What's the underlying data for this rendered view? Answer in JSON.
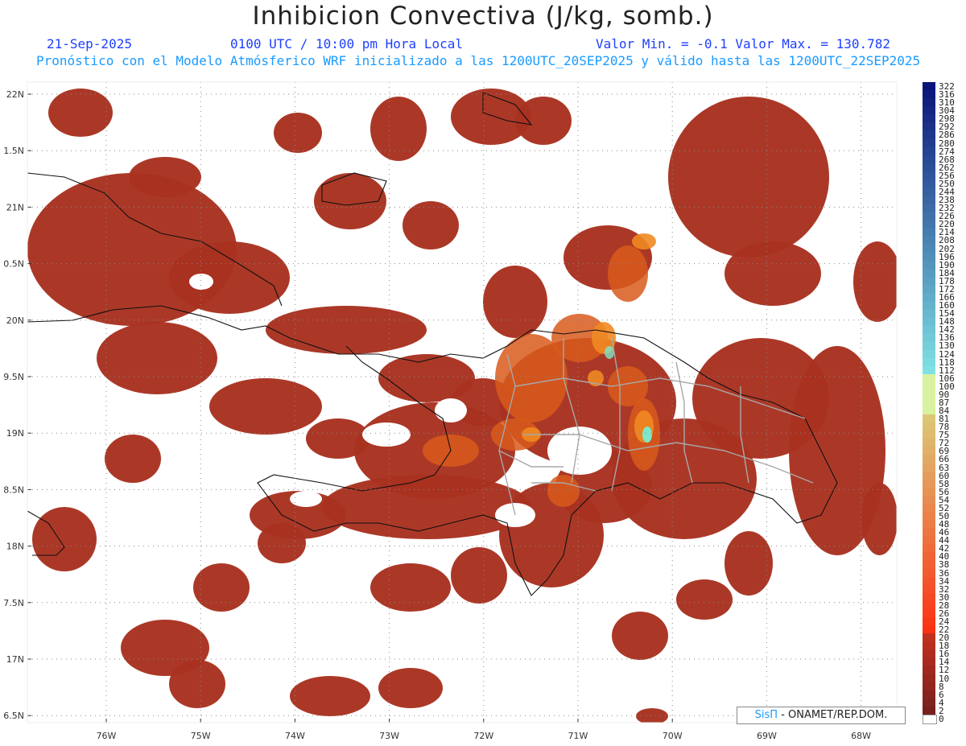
{
  "title": "Inhibicion Convectiva (J/kg, somb.)",
  "date": "21-Sep-2025",
  "time": "0100 UTC / 10:00 pm Hora Local",
  "value_range": "Valor Min. = -0.1  Valor Max. = 130.782",
  "model_info": "Pronóstico con el Modelo Atmósferico WRF inicializado a las 1200UTC_20SEP2025 y válido hasta las  1200UTC_22SEP2025",
  "credit_brand": "SisΠ",
  "credit_text": " - ONAMET/REP.DOM.",
  "lat_labels": [
    "22N",
    "1.5N",
    "21N",
    "0.5N",
    "20N",
    "9.5N",
    "19N",
    "8.5N",
    "18N",
    "7.5N",
    "17N",
    "6.5N"
  ],
  "lon_labels": [
    "76W",
    "75W",
    "74W",
    "73W",
    "72W",
    "71W",
    "70W",
    "69W",
    "68W"
  ],
  "colorbar_labels": [
    "322",
    "316",
    "310",
    "304",
    "298",
    "292",
    "286",
    "280",
    "274",
    "268",
    "262",
    "256",
    "250",
    "244",
    "238",
    "232",
    "226",
    "220",
    "214",
    "208",
    "202",
    "196",
    "190",
    "184",
    "178",
    "172",
    "166",
    "160",
    "154",
    "148",
    "142",
    "136",
    "130",
    "124",
    "118",
    "112",
    "106",
    "100",
    "90",
    "87",
    "84",
    "81",
    "78",
    "75",
    "72",
    "69",
    "66",
    "63",
    "60",
    "58",
    "56",
    "54",
    "52",
    "50",
    "48",
    "46",
    "44",
    "42",
    "40",
    "38",
    "36",
    "34",
    "32",
    "30",
    "28",
    "26",
    "24",
    "22",
    "20",
    "18",
    "16",
    "14",
    "12",
    "10",
    "8",
    "6",
    "4",
    "2",
    "0"
  ],
  "colors": {
    "field_base": "#a83220",
    "field_mid": "#d85a1c",
    "field_high": "#f08a22",
    "peak": "#7fe6c8",
    "coast": "#111111",
    "provinces": "#a8a8a8"
  }
}
